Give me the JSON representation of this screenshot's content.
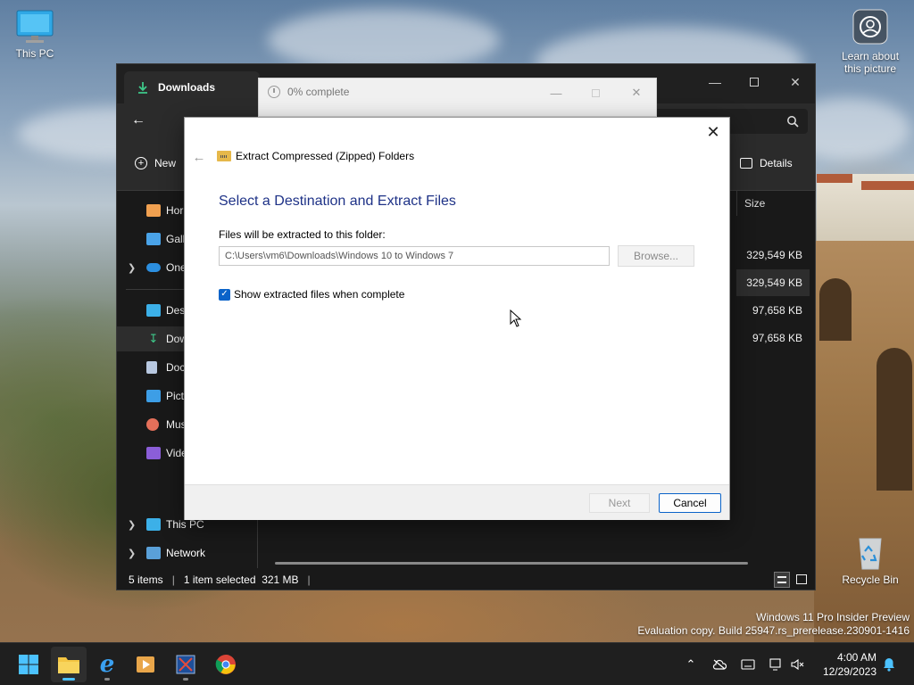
{
  "desktop": {
    "icons": {
      "this_pc": "This PC",
      "learn_line1": "Learn about",
      "learn_line2": "this picture",
      "recycle_bin": "Recycle Bin"
    },
    "watermark_line1": "Windows 11 Pro Insider Preview",
    "watermark_line2": "Evaluation copy. Build 25947.rs_prerelease.230901-1416"
  },
  "explorer": {
    "tab_title": "Downloads",
    "new_label": "New",
    "details_label": "Details",
    "nav": {
      "home": "Hor",
      "gallery": "Gall",
      "onedrive": "One",
      "desktop": "Desl",
      "downloads": "Dow",
      "documents": "Doc",
      "pictures": "Pict",
      "music": "Mus",
      "videos": "Vide",
      "this_pc": "This PC",
      "network": "Network"
    },
    "columns": {
      "size": "Size"
    },
    "sizes": [
      "329,549 KB",
      "329,549 KB",
      "97,658 KB",
      "97,658 KB"
    ],
    "status": {
      "items": "5 items",
      "selected": "1 item selected  321 MB"
    }
  },
  "progress_window": {
    "title": "0% complete"
  },
  "wizard": {
    "window_title": "Extract Compressed (Zipped) Folders",
    "heading": "Select a Destination and Extract Files",
    "folder_label": "Files will be extracted to this folder:",
    "path_value": "C:\\Users\\vm6\\Downloads\\Windows 10 to Windows 7",
    "browse_label": "Browse...",
    "checkbox_label": "Show extracted files when complete",
    "checkbox_checked": true,
    "next_label": "Next",
    "cancel_label": "Cancel"
  },
  "taskbar": {
    "time": "4:00 AM",
    "date": "12/29/2023"
  },
  "colors": {
    "accent": "#0a63c9",
    "heading_blue": "#1e3287",
    "explorer_bg": "#191919",
    "taskbar_bg": "#1f1f1f"
  }
}
